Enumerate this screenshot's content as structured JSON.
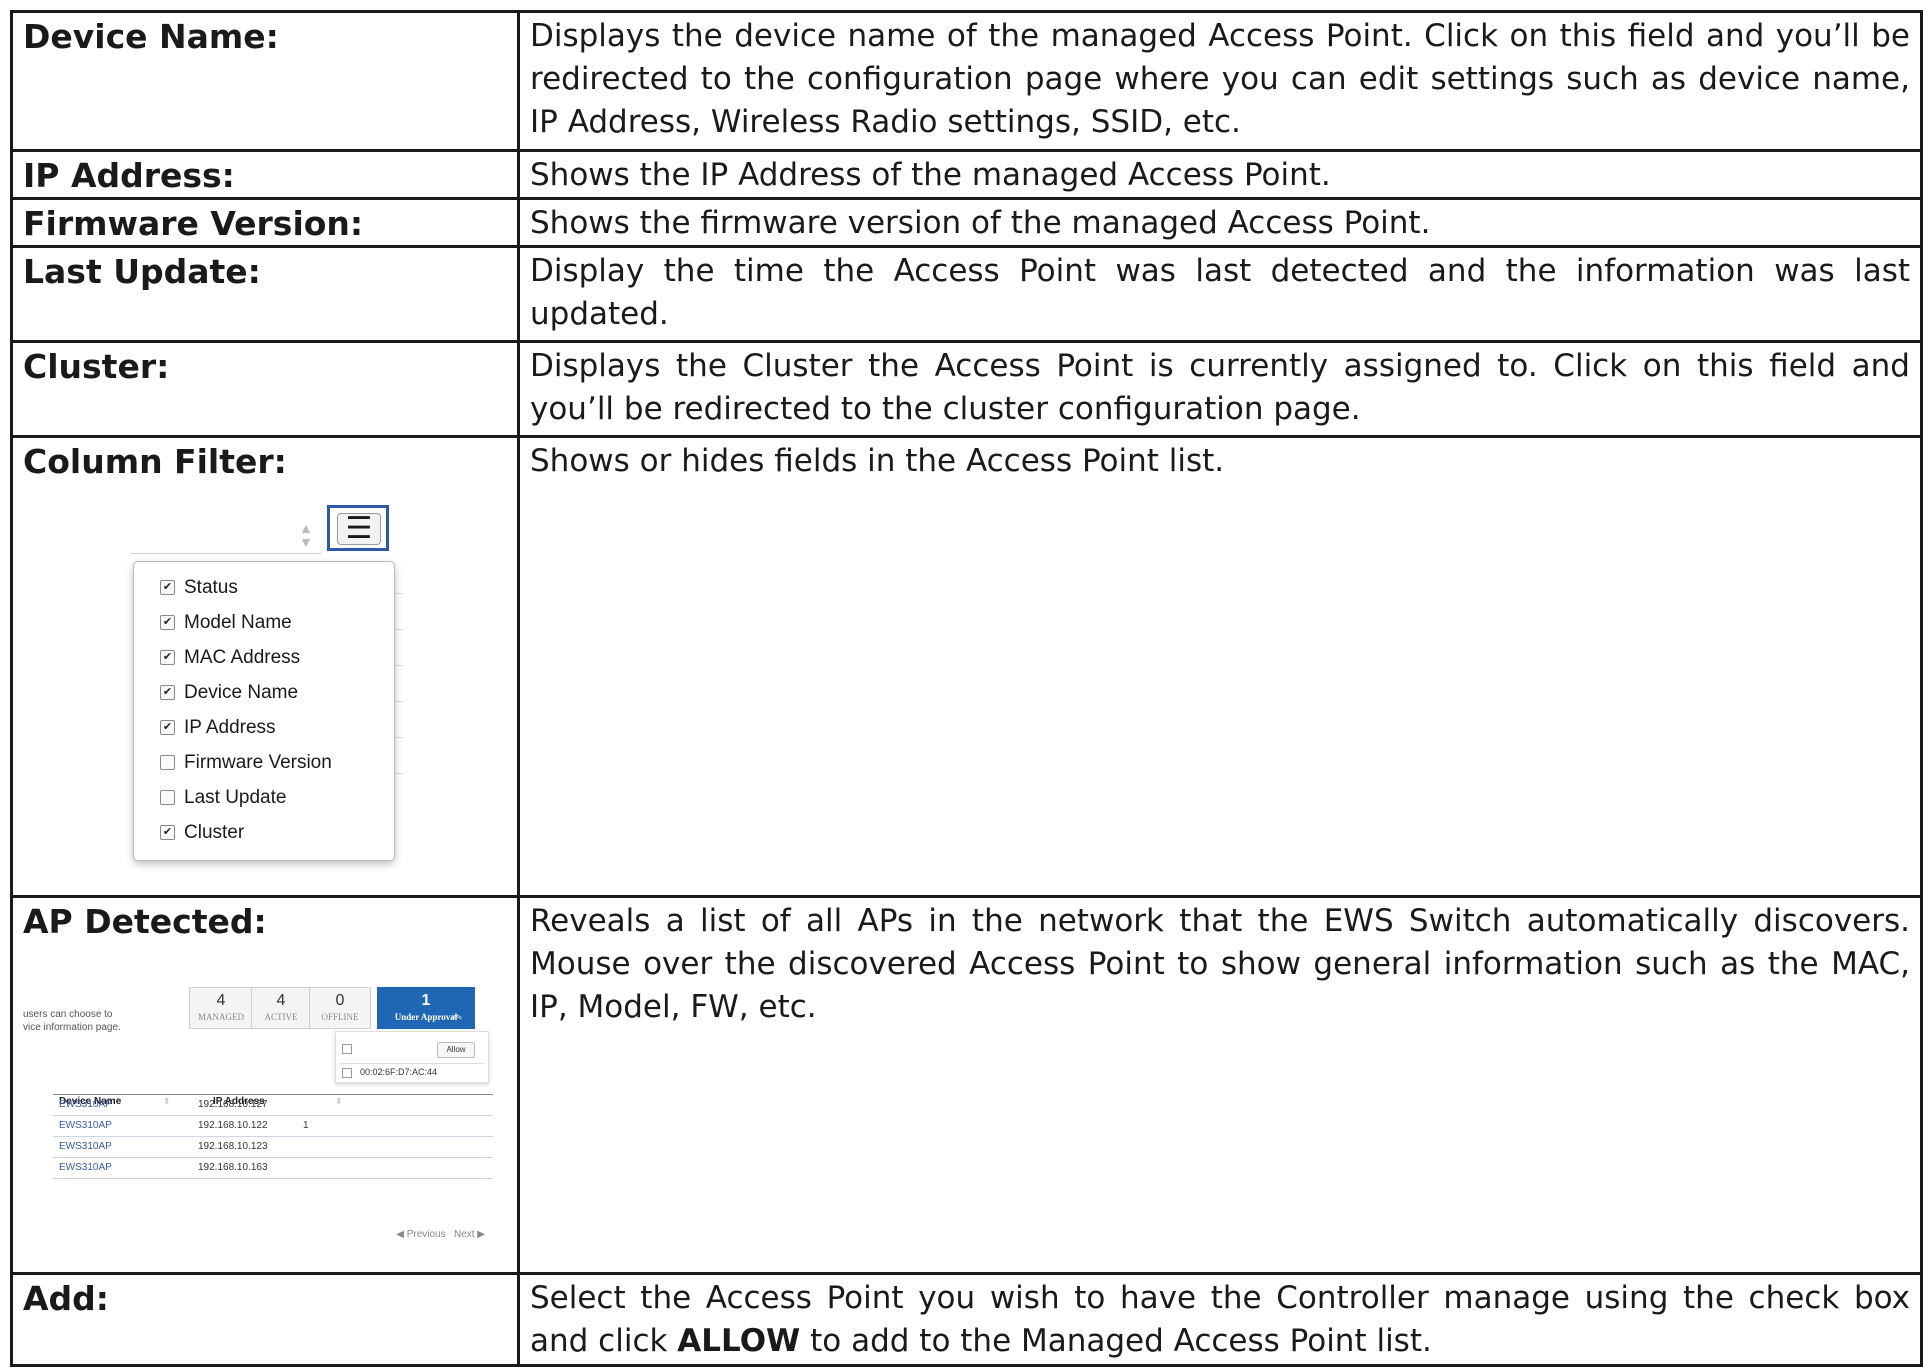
{
  "rows": [
    {
      "term": "Device Name:",
      "desc": "Displays the device name of the managed Access Point. Click on this field and you’ll be redirected to the configuration page where you can edit settings such as device name, IP Address, Wireless Radio settings, SSID, etc."
    },
    {
      "term": "IP Address:",
      "desc": "Shows the IP Address of the managed Access Point."
    },
    {
      "term": "Firmware Version:",
      "desc": "Shows the firmware version of the managed Access Point."
    },
    {
      "term": "Last Update:",
      "desc": "Display the time the Access Point was last detected and the information was last updated."
    },
    {
      "term": "Cluster:",
      "desc": "Displays the Cluster the Access Point is currently assigned to. Click on this field and you’ll be redirected to the cluster configuration page."
    },
    {
      "term": "Column Filter:",
      "desc": "Shows or hides fields in the Access Point list."
    },
    {
      "term": "AP Detected:",
      "desc": "Reveals a list of all APs in the network that the EWS Switch automatically discovers. Mouse over the discovered Access Point to show general information such as the MAC, IP, Model, FW, etc."
    },
    {
      "term": "Add:",
      "desc_before": "Select the Access Point you wish to have the Controller manage using the check box and click ",
      "desc_bold": "ALLOW",
      "desc_after": " to add to the Managed Access Point list."
    }
  ],
  "column_filter": {
    "items": [
      {
        "label": "Status",
        "checked": true,
        "mark": "✔"
      },
      {
        "label": "Model Name",
        "checked": true,
        "mark": "✔"
      },
      {
        "label": "MAC Address",
        "checked": true,
        "mark": "✔"
      },
      {
        "label": "Device Name",
        "checked": true,
        "mark": "✔"
      },
      {
        "label": "IP Address",
        "checked": true,
        "mark": "✔"
      },
      {
        "label": "Firmware Version",
        "checked": false,
        "mark": ""
      },
      {
        "label": "Last Update",
        "checked": false,
        "mark": ""
      },
      {
        "label": "Cluster",
        "checked": true,
        "mark": "✔"
      }
    ]
  },
  "ap_detected": {
    "hint_line1": "users can choose to",
    "hint_line2": "vice information page.",
    "stats": [
      {
        "number": "4",
        "label": "MANAGED"
      },
      {
        "number": "4",
        "label": "ACTIVE"
      },
      {
        "number": "0",
        "label": "OFFLINE"
      },
      {
        "number": "1",
        "label": "Under Approval"
      }
    ],
    "popup": {
      "allow": "Allow",
      "mac": "00:02:6F:D7:AC:44"
    },
    "headers": {
      "device_name": "Device Name",
      "ip_address": "IP Address"
    },
    "rows": [
      {
        "device": "EWS310AP",
        "ip": "192.168.10.127",
        "extra": ""
      },
      {
        "device": "EWS310AP",
        "ip": "192.168.10.122",
        "extra": "1"
      },
      {
        "device": "EWS310AP",
        "ip": "192.168.10.123",
        "extra": ""
      },
      {
        "device": "EWS310AP",
        "ip": "192.168.10.163",
        "extra": ""
      }
    ],
    "pager": {
      "previous": "Previous",
      "next": "Next"
    }
  }
}
